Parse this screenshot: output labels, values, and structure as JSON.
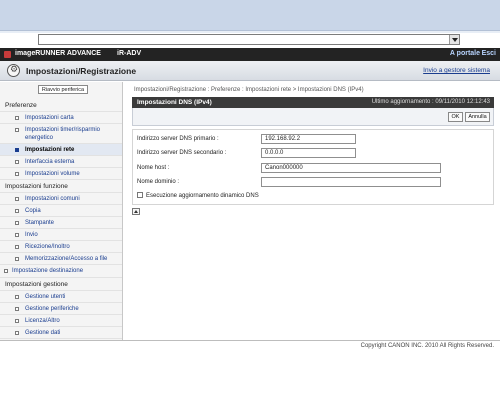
{
  "header": {
    "brand": "imageRUNNER ADVANCE",
    "model": "iR-ADV",
    "portal_link": "A portale",
    "logout_link": "Esci"
  },
  "titlebar": {
    "title": "Impostazioni/Registrazione",
    "send_link": "Invio a gestore sistema"
  },
  "sidebar": {
    "restart_button": "Riavvio periferica",
    "groups": [
      {
        "label": "Preferenze",
        "items": [
          {
            "label": "Impostazioni carta"
          },
          {
            "label": "Impostazioni timer/risparmio energetico"
          },
          {
            "label": "Impostazioni rete",
            "selected": true
          },
          {
            "label": "Interfaccia esterna"
          },
          {
            "label": "Impostazioni volume"
          }
        ]
      },
      {
        "label": "Impostazioni funzione",
        "items": [
          {
            "label": "Impostazioni comuni"
          },
          {
            "label": "Copia"
          },
          {
            "label": "Stampante"
          },
          {
            "label": "Invio"
          },
          {
            "label": "Ricezione/Inoltro"
          },
          {
            "label": "Memorizzazione/Accesso a file"
          }
        ]
      }
    ],
    "top_item": "Impostazione destinazione",
    "management": {
      "label": "Impostazioni gestione",
      "items": [
        {
          "label": "Gestione utenti"
        },
        {
          "label": "Gestione periferiche"
        },
        {
          "label": "Licenza/Altro"
        },
        {
          "label": "Gestione dati"
        }
      ]
    }
  },
  "content": {
    "breadcrumb": "Impostazioni/Registrazione : Preferenze : Impostazioni rete > Impostazioni DNS (IPv4)",
    "panel_title": "Impostazioni DNS (IPv4)",
    "last_update": "Ultimo aggiornamento : 09/11/2010 12:12:43",
    "ok_button": "OK",
    "cancel_button": "Annulla",
    "fields": {
      "primary_dns_label": "Indirizzo server DNS primario :",
      "primary_dns_value": "192.168.92.2",
      "secondary_dns_label": "Indirizzo server DNS secondario :",
      "secondary_dns_value": "0.0.0.0",
      "host_name_label": "Nome host :",
      "host_name_value": "Canon000000",
      "domain_name_label": "Nome dominio :",
      "domain_name_value": ""
    },
    "dynamic_dns_label": "Esecuzione aggiornamento dinamico DNS",
    "dynamic_dns_checked": false
  },
  "footer": {
    "copyright": "Copyright CANON INC. 2010 All Rights Reserved."
  }
}
